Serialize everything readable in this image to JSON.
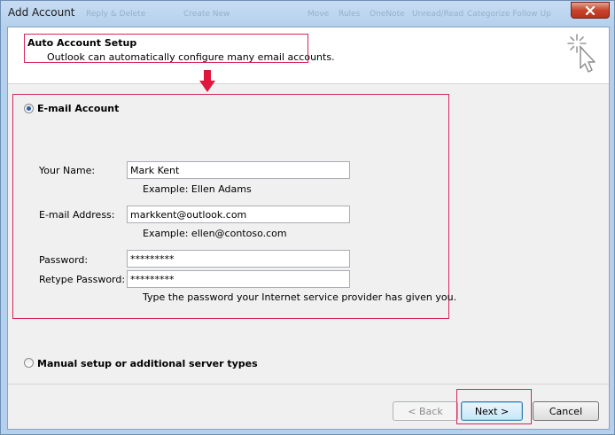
{
  "window": {
    "title": "Add Account",
    "background_toolbar": [
      "Reply & Delete",
      "Create New",
      "Move",
      "Rules",
      "OneNote",
      "Unread/Read",
      "Categorize Follow Up"
    ]
  },
  "header": {
    "title": "Auto Account Setup",
    "subtitle": "Outlook can automatically configure many email accounts."
  },
  "email_account": {
    "option_label": "E-mail Account",
    "selected": true,
    "fields": {
      "name": {
        "label": "Your Name:",
        "value": "Mark Kent",
        "example": "Example: Ellen Adams"
      },
      "email": {
        "label": "E-mail Address:",
        "value": "markkent@outlook.com",
        "example": "Example: ellen@contoso.com"
      },
      "password": {
        "label": "Password:",
        "value": "*********"
      },
      "retype": {
        "label": "Retype Password:",
        "value": "*********"
      }
    },
    "password_hint": "Type the password your Internet service provider has given you."
  },
  "manual_setup": {
    "option_label": "Manual setup or additional server types",
    "selected": false
  },
  "buttons": {
    "back": "< Back",
    "next": "Next >",
    "cancel": "Cancel"
  },
  "colors": {
    "highlight": "#d6245a",
    "accent": "#2b5fa6"
  }
}
